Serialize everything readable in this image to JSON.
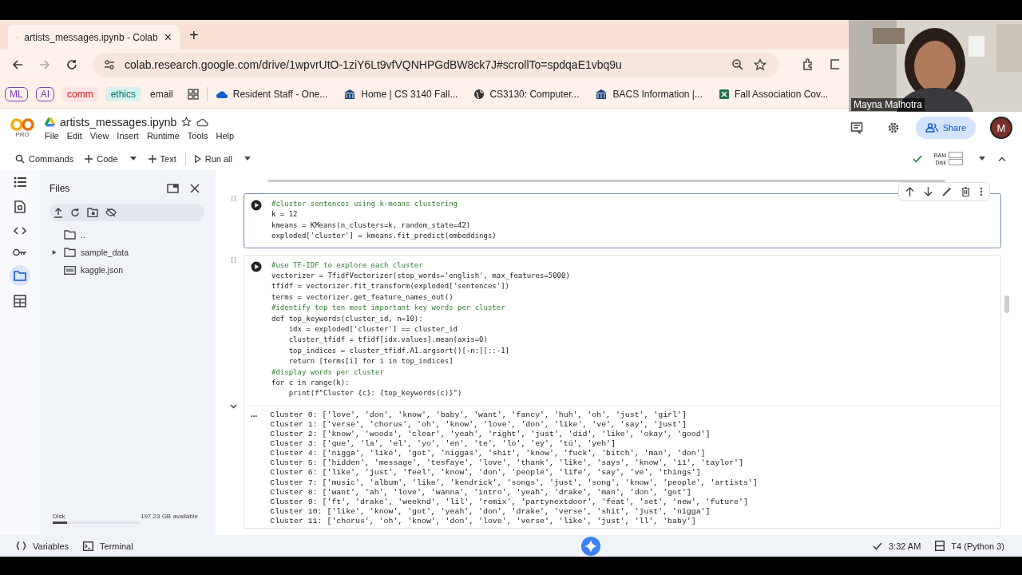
{
  "browser": {
    "tab": {
      "title": "artists_messages.ipynb - Colab",
      "close": "×"
    },
    "new_tab": "+",
    "url": "colab.research.google.com/drive/1wpvrUtO-1ziY6Lt9vfVQNHPGdBW8ck7J#scrollTo=spdqaE1vbq9u",
    "bookmarks": [
      {
        "label": "ML",
        "kind": "chip",
        "color": "#7b3fb5"
      },
      {
        "label": "AI",
        "kind": "chip",
        "color": "#7b3fb5"
      },
      {
        "label": "comm",
        "kind": "tag",
        "color": "#c5221f"
      },
      {
        "label": "ethics",
        "kind": "tag",
        "color": "#00796b"
      },
      {
        "label": "email",
        "kind": "plain"
      },
      {
        "label": "Resident Staff - One...",
        "kind": "cloud"
      },
      {
        "label": "Home | CS 3140 Fall...",
        "kind": "building"
      },
      {
        "label": "CS3130: Computer...",
        "kind": "globe"
      },
      {
        "label": "BACS Information |...",
        "kind": "building"
      },
      {
        "label": "Fall Association Cov...",
        "kind": "sheet"
      }
    ]
  },
  "webcam": {
    "name": "Mayna Malhotra"
  },
  "colab": {
    "badge": "PRO",
    "notebook_title": "artists_messages.ipynb",
    "menu": [
      "File",
      "Edit",
      "View",
      "Insert",
      "Runtime",
      "Tools",
      "Help"
    ],
    "share": "Share",
    "avatar": "M"
  },
  "toolbar": {
    "commands": "Commands",
    "code": "Code",
    "text": "Text",
    "run_all": "Run all",
    "ram": "RAM",
    "disk": "Disk"
  },
  "files_panel": {
    "title": "Files",
    "tree": [
      {
        "name": "..",
        "kind": "parent"
      },
      {
        "name": "sample_data",
        "kind": "folder",
        "expanded": false
      },
      {
        "name": "kaggle.json",
        "kind": "json"
      }
    ],
    "disk": {
      "label": "Disk",
      "level": 0.16
    },
    "available": "197.23 GB available"
  },
  "cells": [
    {
      "bracket": "[ ]",
      "selected": true,
      "lines": [
        {
          "text": "#cluster sentences using k-means clustering",
          "kind": "comment"
        },
        {
          "text": "k = 12",
          "kind": "code"
        },
        {
          "text": "kmeans = KMeans(n_clusters=k, random_state=42)",
          "kind": "code"
        },
        {
          "text": "exploded['cluster'] = kmeans.fit_predict(embeddings)",
          "kind": "code"
        }
      ]
    },
    {
      "bracket": "[ ]",
      "selected": false,
      "lines": [
        {
          "text": "#use TF-IDF to explore each cluster",
          "kind": "comment"
        },
        {
          "text": "vectorizer = TfidfVectorizer(stop_words='english', max_features=5000)",
          "kind": "code"
        },
        {
          "text": "tfidf = vectorizer.fit_transform(exploded['sentences'])",
          "kind": "code"
        },
        {
          "text": "terms = vectorizer.get_feature_names_out()",
          "kind": "code"
        },
        {
          "text": "#identify top ten most important key words per cluster",
          "kind": "comment"
        },
        {
          "text": "def top_keywords(cluster_id, n=10):",
          "kind": "code"
        },
        {
          "text": "    idx = exploded['cluster'] == cluster_id",
          "kind": "code"
        },
        {
          "text": "    cluster_tfidf = tfidf[idx.values].mean(axis=0)",
          "kind": "code"
        },
        {
          "text": "    top_indices = cluster_tfidf.A1.argsort()[-n:][::-1]",
          "kind": "code"
        },
        {
          "text": "    return [terms[i] for i in top_indices]",
          "kind": "code"
        },
        {
          "text": "#display words per cluster",
          "kind": "comment"
        },
        {
          "text": "for c in range(k):",
          "kind": "code"
        },
        {
          "text": "    print(f\"Cluster {c}: {top_keywords(c)}\")",
          "kind": "code"
        }
      ],
      "output": {
        "marker": "...",
        "lines": [
          "Cluster 0: ['love', 'don', 'know', 'baby', 'want', 'fancy', 'huh', 'oh', 'just', 'girl']",
          "Cluster 1: ['verse', 'chorus', 'oh', 'know', 'love', 'don', 'like', 've', 'say', 'just']",
          "Cluster 2: ['know', 'woods', 'clear', 'yeah', 'right', 'just', 'did', 'like', 'okay', 'good']",
          "Cluster 3: ['que', 'la', 'el', 'yo', 'en', 'te', 'lo', 'ey', 'tú', 'yeh']",
          "Cluster 4: ['nigga', 'like', 'got', 'niggas', 'shit', 'know', 'fuck', 'bitch', 'man', 'don']",
          "Cluster 5: ['hidden', 'message', 'tesfaye', 'love', 'thank', 'like', 'says', 'know', '11', 'taylor']",
          "Cluster 6: ['like', 'just', 'feel', 'know', 'don', 'people', 'life', 'say', 've', 'things']",
          "Cluster 7: ['music', 'album', 'like', 'kendrick', 'songs', 'just', 'song', 'know', 'people', 'artists']",
          "Cluster 8: ['want', 'ah', 'love', 'wanna', 'intro', 'yeah', 'drake', 'man', 'don', 'got']",
          "Cluster 9: ['ft', 'drake', 'weeknd', 'lil', 'remix', 'partynextdoor', 'feat', 'set', 'new', 'future']",
          "Cluster 10: ['like', 'know', 'got', 'yeah', 'don', 'drake', 'verse', 'shit', 'just', 'nigga']",
          "Cluster 11: ['chorus', 'oh', 'know', 'don', 'love', 'verse', 'like', 'just', 'll', 'baby']"
        ]
      }
    }
  ],
  "status_bar": {
    "variables": "Variables",
    "terminal": "Terminal",
    "time": "3:32 AM",
    "runtime": "T4 (Python 3)"
  }
}
